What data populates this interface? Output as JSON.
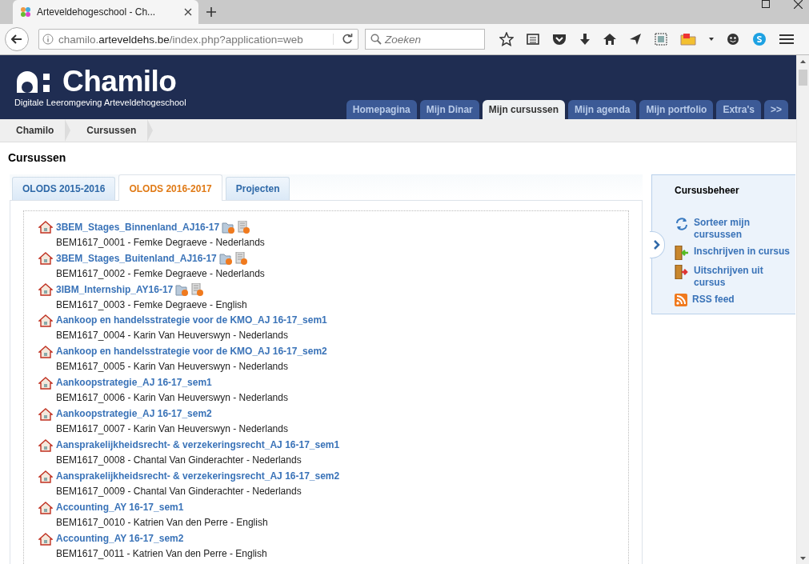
{
  "browser": {
    "tab_title": "Arteveldehogeschool - Ch...",
    "url_prefix": "chamilo.",
    "url_domain": "arteveldehs.be",
    "url_path": "/index.php?application=web",
    "search_placeholder": "Zoeken"
  },
  "header": {
    "logo_text": "Chamilo",
    "subtitle": "Digitale Leeromgeving Arteveldehogeschool",
    "nav": [
      {
        "label": "Homepagina",
        "selected": false
      },
      {
        "label": "Mijn Dinar",
        "selected": false
      },
      {
        "label": "Mijn cursussen",
        "selected": true
      },
      {
        "label": "Mijn agenda",
        "selected": false
      },
      {
        "label": "Mijn portfolio",
        "selected": false
      },
      {
        "label": "Extra's",
        "selected": false
      },
      {
        "label": ">>",
        "selected": false
      }
    ]
  },
  "breadcrumb": [
    "Chamilo",
    "Cursussen"
  ],
  "page_title": "Cursussen",
  "course_tabs": [
    {
      "label": "OLODS 2015-2016",
      "selected": false
    },
    {
      "label": "OLODS 2016-2017",
      "selected": true
    },
    {
      "label": "Projecten",
      "selected": false
    }
  ],
  "courses": [
    {
      "title": "3BEM_Stages_Binnenland_AJ16-17",
      "details": "BEM1617_0001 - Femke Degraeve - Nederlands",
      "tools": true
    },
    {
      "title": "3BEM_Stages_Buitenland_AJ16-17",
      "details": "BEM1617_0002 - Femke Degraeve - Nederlands",
      "tools": true
    },
    {
      "title": "3IBM_Internship_AY16-17",
      "details": "BEM1617_0003 - Femke Degraeve - English",
      "tools": true
    },
    {
      "title": "Aankoop en handelsstrategie voor de KMO_AJ 16-17_sem1",
      "details": "BEM1617_0004 - Karin Van Heuverswyn - Nederlands",
      "tools": false
    },
    {
      "title": "Aankoop en handelsstrategie voor de KMO_AJ 16-17_sem2",
      "details": "BEM1617_0005 - Karin Van Heuverswyn - Nederlands",
      "tools": false
    },
    {
      "title": "Aankoopstrategie_AJ 16-17_sem1",
      "details": "BEM1617_0006 - Karin Van Heuverswyn - Nederlands",
      "tools": false
    },
    {
      "title": "Aankoopstrategie_AJ 16-17_sem2",
      "details": "BEM1617_0007 - Karin Van Heuverswyn - Nederlands",
      "tools": false
    },
    {
      "title": "Aansprakelijkheidsrecht- & verzekeringsrecht_AJ 16-17_sem1",
      "details": "BEM1617_0008 - Chantal Van Ginderachter - Nederlands",
      "tools": false
    },
    {
      "title": "Aansprakelijkheidsrecht- & verzekeringsrecht_AJ 16-17_sem2",
      "details": "BEM1617_0009 - Chantal Van Ginderachter - Nederlands",
      "tools": false
    },
    {
      "title": "Accounting_AY 16-17_sem1",
      "details": "BEM1617_0010 - Katrien Van den Perre - English",
      "tools": false
    },
    {
      "title": "Accounting_AY 16-17_sem2",
      "details": "BEM1617_0011 - Katrien Van den Perre - English",
      "tools": false
    }
  ],
  "side_panel": {
    "title": "Cursusbeheer",
    "links": [
      {
        "kind": "sort",
        "label": "Sorteer mijn cursussen"
      },
      {
        "kind": "subscribe",
        "label": "Inschrijven in cursus"
      },
      {
        "kind": "unsubscribe",
        "label": "Uitschrijven uit cursus"
      },
      {
        "kind": "rss",
        "label": "RSS feed"
      }
    ]
  }
}
